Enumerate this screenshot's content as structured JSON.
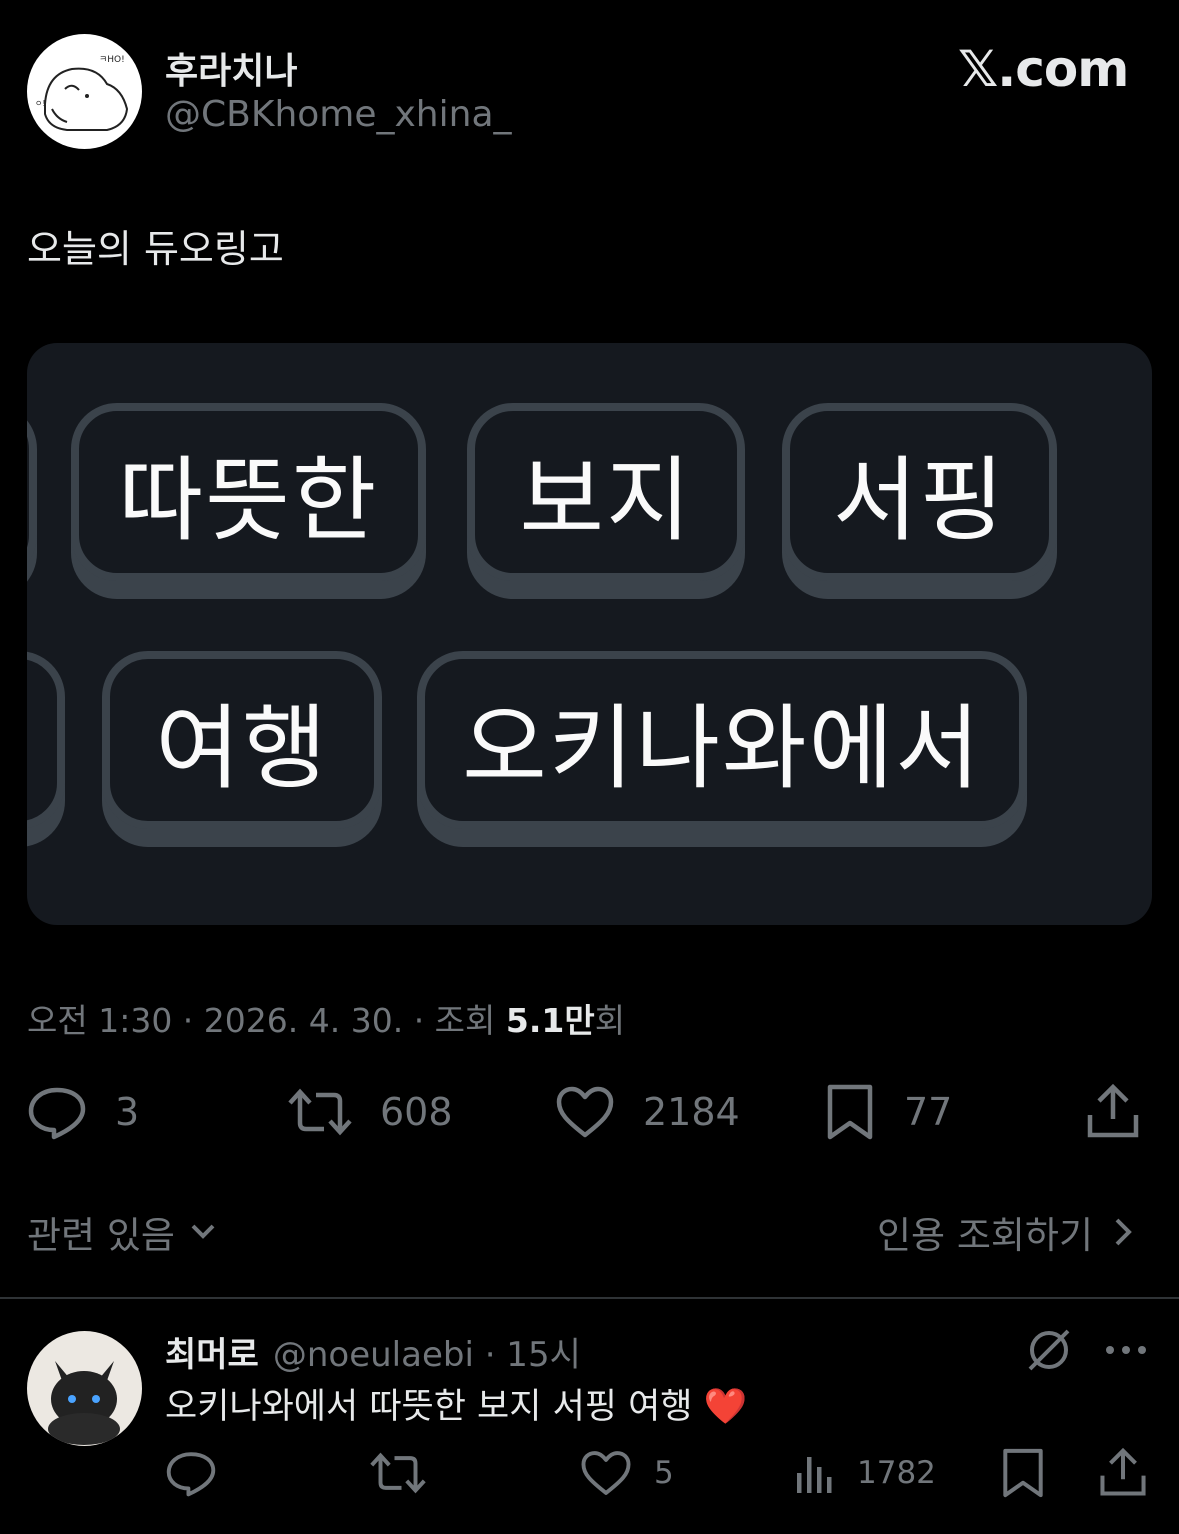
{
  "author": {
    "display_name": "후라치나",
    "handle": "@CBKhome_xhina_"
  },
  "brand": "𝕏.com",
  "tweet": {
    "text": "오늘의 듀오링고",
    "time": "오전 1:30 · 2026. 4. 30. · 조회 ",
    "views": "5.1만",
    "views_suffix": "회"
  },
  "media": {
    "keys_row1": [
      "따뜻한",
      "보지",
      "서핑"
    ],
    "keys_row2": [
      "여행",
      "오키나와에서"
    ]
  },
  "actions": {
    "replies": "3",
    "retweets": "608",
    "likes": "2184",
    "bookmarks": "77"
  },
  "related_label": "관련 있음",
  "quotes_label": "인용 조회하기",
  "reply": {
    "display_name": "최머로",
    "handle_time": "@noeulaebi · 15시",
    "text": "오키나와에서 따뜻한 보지 서핑 여행 ❤️",
    "likes": "5",
    "views": "1782"
  },
  "colors": {
    "background": "#000000",
    "secondary_text": "#71767b",
    "primary_text": "#e7e9ea",
    "card": "#15191f",
    "key_border": "#3b434b"
  }
}
